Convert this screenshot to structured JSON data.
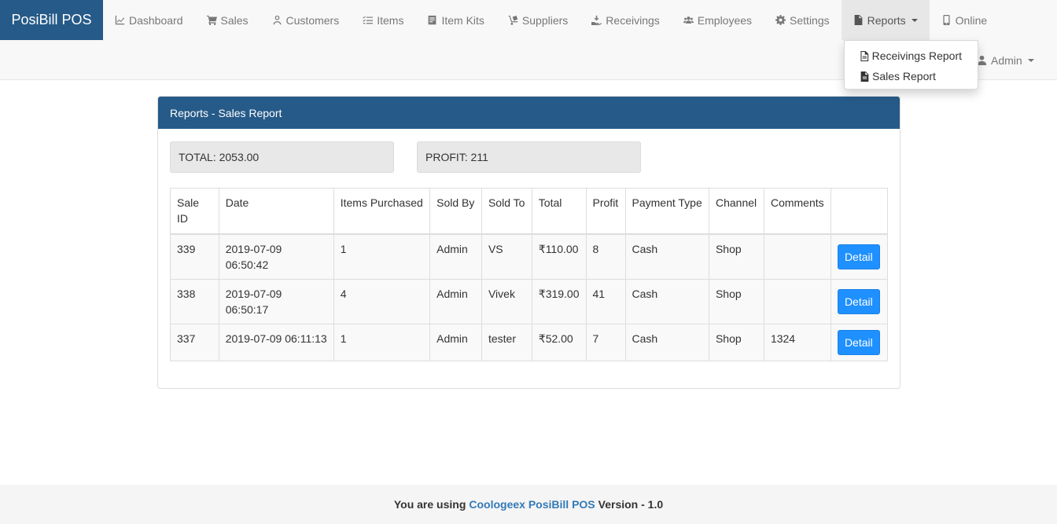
{
  "app": {
    "brand": "PosiBill POS"
  },
  "nav": {
    "items": [
      {
        "label": "Dashboard",
        "icon": "chart-line-icon"
      },
      {
        "label": "Sales",
        "icon": "cart-icon"
      },
      {
        "label": "Customers",
        "icon": "user-icon"
      },
      {
        "label": "Items",
        "icon": "list-check-icon"
      },
      {
        "label": "Item Kits",
        "icon": "box-icon"
      },
      {
        "label": "Suppliers",
        "icon": "dolly-icon"
      },
      {
        "label": "Receivings",
        "icon": "hand-receive-icon"
      },
      {
        "label": "Employees",
        "icon": "users-icon"
      },
      {
        "label": "Settings",
        "icon": "gear-icon"
      },
      {
        "label": "Reports",
        "icon": "file-icon"
      },
      {
        "label": "Online",
        "icon": "mobile-icon"
      }
    ],
    "admin_label": "Admin"
  },
  "reports_dropdown": {
    "items": [
      {
        "label": "Receivings Report",
        "icon": "file-outline-icon"
      },
      {
        "label": "Sales Report",
        "icon": "file-icon"
      }
    ]
  },
  "panel": {
    "title": "Reports - Sales Report",
    "total_label": "TOTAL: 2053.00",
    "profit_label": "PROFIT: 211"
  },
  "table": {
    "headers": [
      "Sale ID",
      "Date",
      "Items Purchased",
      "Sold By",
      "Sold To",
      "Total",
      "Profit",
      "Payment Type",
      "Channel",
      "Comments",
      ""
    ],
    "rows": [
      {
        "sale_id": "339",
        "date": "2019-07-09 06:50:42",
        "items": "1",
        "sold_by": "Admin",
        "sold_to": "VS",
        "total": "₹110.00",
        "profit": "8",
        "payment": "Cash",
        "channel": "Shop",
        "comments": "",
        "action": "Detail"
      },
      {
        "sale_id": "338",
        "date": "2019-07-09 06:50:17",
        "items": "4",
        "sold_by": "Admin",
        "sold_to": "Vivek",
        "total": "₹319.00",
        "profit": "41",
        "payment": "Cash",
        "channel": "Shop",
        "comments": "",
        "action": "Detail"
      },
      {
        "sale_id": "337",
        "date": "2019-07-09 06:11:13",
        "items": "1",
        "sold_by": "Admin",
        "sold_to": "tester",
        "total": "₹52.00",
        "profit": "7",
        "payment": "Cash",
        "channel": "Shop",
        "comments": "1324",
        "action": "Detail"
      }
    ]
  },
  "footer": {
    "prefix": "You are using",
    "brand": "Coologeex PosiBill POS",
    "suffix": "Version - 1.0"
  },
  "colors": {
    "brand_bg": "#265a88",
    "button": "#1e90ff",
    "link": "#337ab7"
  }
}
